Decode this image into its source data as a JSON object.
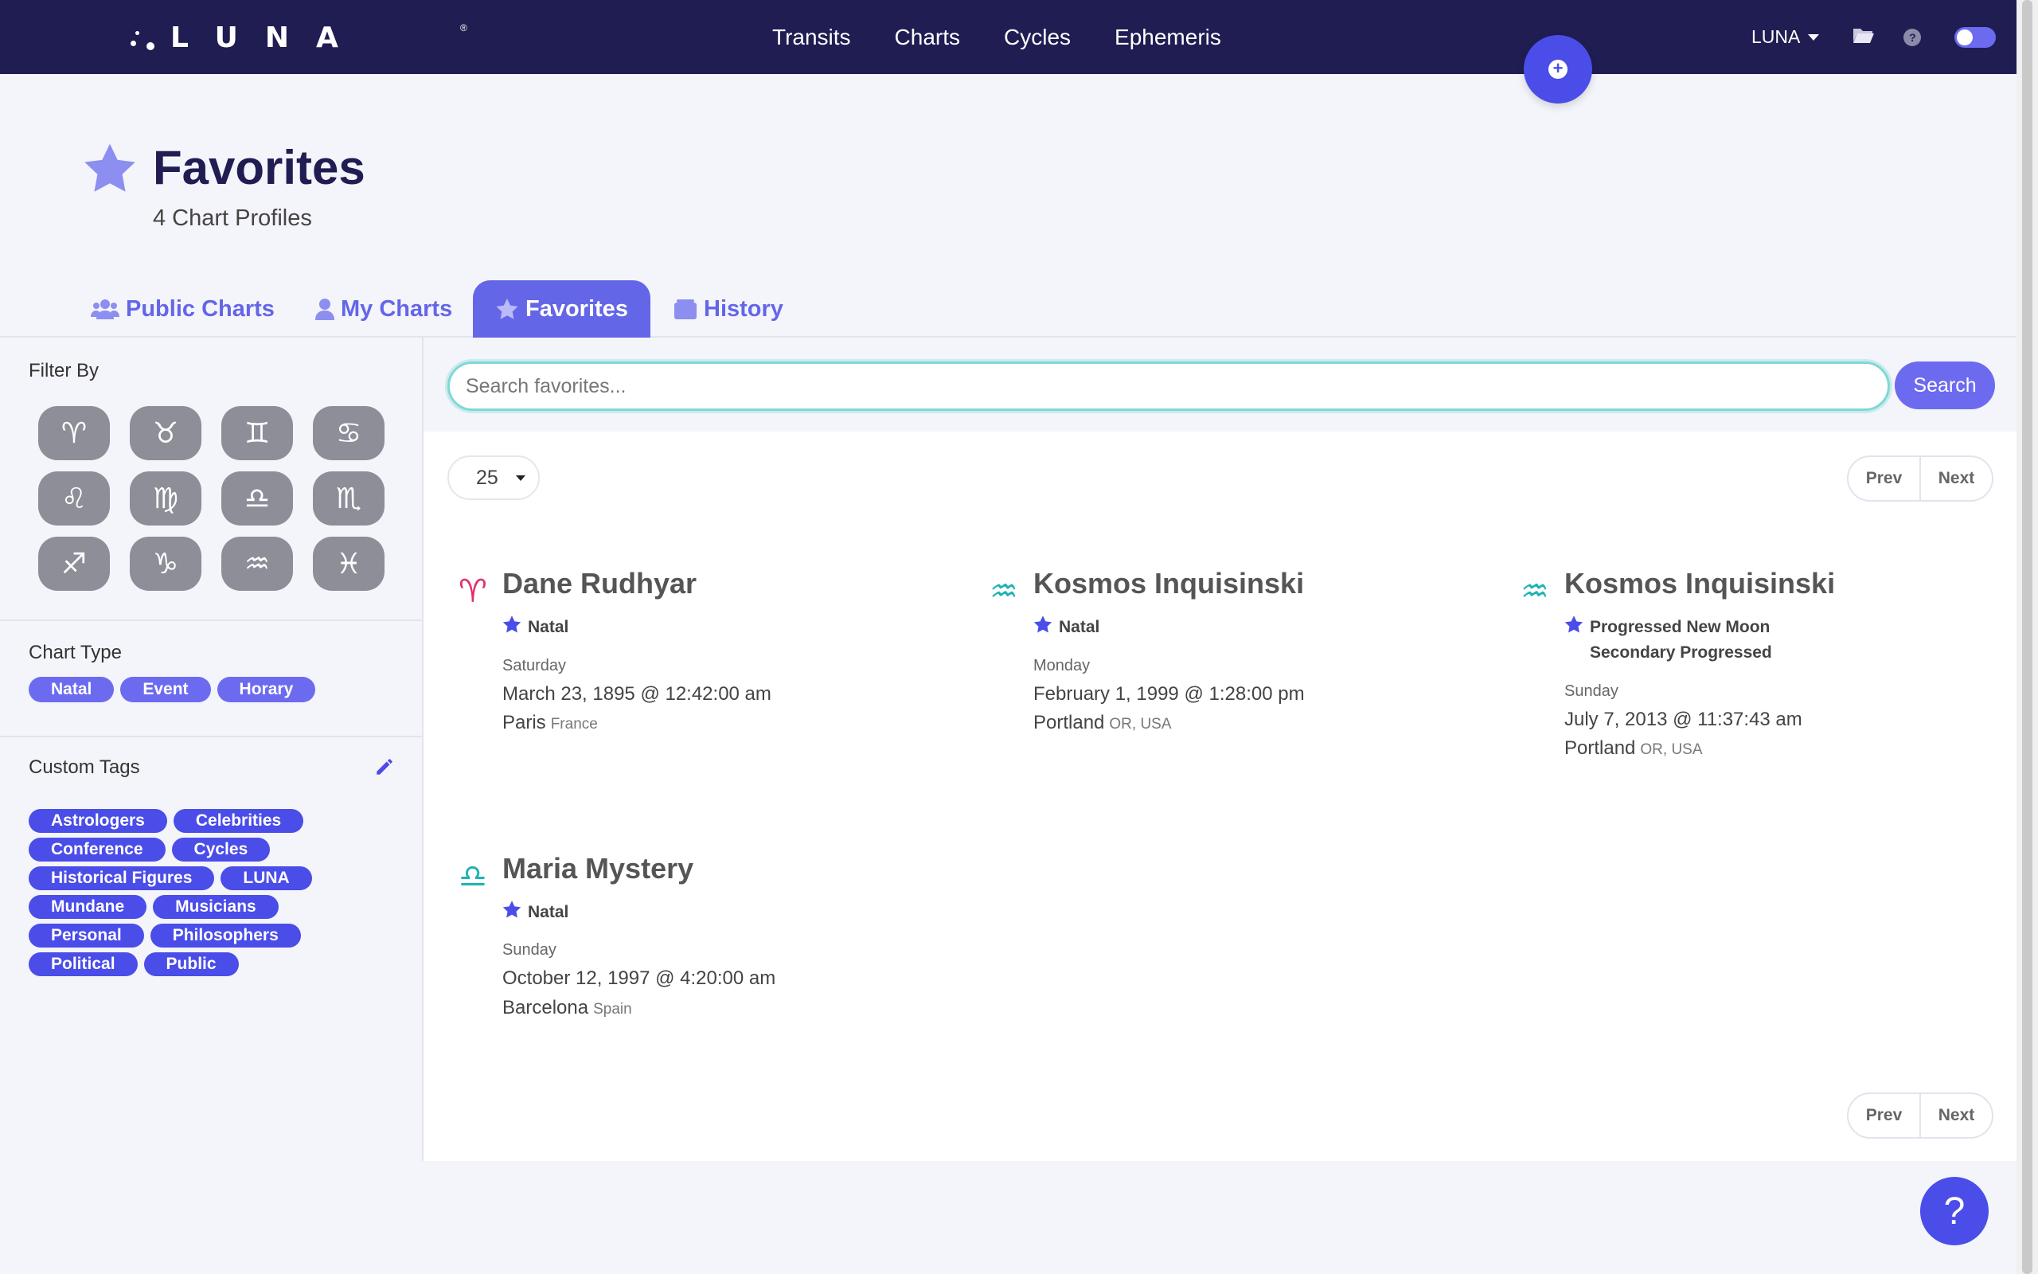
{
  "app": {
    "name": "LUNA",
    "reg_mark": "®"
  },
  "nav": {
    "links": [
      "Transits",
      "Charts",
      "Cycles",
      "Ephemeris"
    ]
  },
  "user_menu": {
    "label": "LUNA"
  },
  "header": {
    "title": "Favorites",
    "subtitle": "4 Chart Profiles"
  },
  "tabs": [
    {
      "label": "Public Charts",
      "icon": "users-icon",
      "active": false
    },
    {
      "label": "My Charts",
      "icon": "user-icon",
      "active": false
    },
    {
      "label": "Favorites",
      "icon": "star-icon",
      "active": true
    },
    {
      "label": "History",
      "icon": "history-icon",
      "active": false
    }
  ],
  "sidebar": {
    "filter_label": "Filter By",
    "zodiac": [
      {
        "name": "aries",
        "glyph": "♈︎"
      },
      {
        "name": "taurus",
        "glyph": "♉︎"
      },
      {
        "name": "gemini",
        "glyph": "♊︎"
      },
      {
        "name": "cancer",
        "glyph": "♋︎"
      },
      {
        "name": "leo",
        "glyph": "♌︎"
      },
      {
        "name": "virgo",
        "glyph": "♍︎"
      },
      {
        "name": "libra",
        "glyph": "♎︎"
      },
      {
        "name": "scorpio",
        "glyph": "♏︎"
      },
      {
        "name": "sagittarius",
        "glyph": "♐︎"
      },
      {
        "name": "capricorn",
        "glyph": "♑︎"
      },
      {
        "name": "aquarius",
        "glyph": "♒︎"
      },
      {
        "name": "pisces",
        "glyph": "♓︎"
      }
    ],
    "chart_type_label": "Chart Type",
    "chart_types": [
      "Natal",
      "Event",
      "Horary"
    ],
    "custom_tags_label": "Custom Tags",
    "custom_tags": [
      "Astrologers",
      "Celebrities",
      "Conference",
      "Cycles",
      "Historical Figures",
      "LUNA",
      "Mundane",
      "Musicians",
      "Personal",
      "Philosophers",
      "Political",
      "Public"
    ]
  },
  "search": {
    "placeholder": "Search favorites...",
    "button_label": "Search"
  },
  "pagination": {
    "per_page": "25",
    "prev": "Prev",
    "next": "Next"
  },
  "charts": [
    {
      "name": "Dane Rudhyar",
      "sign": "aries",
      "sign_glyph": "♈︎",
      "sign_color": "#e0306a",
      "types": [
        "Natal"
      ],
      "day": "Saturday",
      "datetime": "March 23, 1895 @ 12:42:00 am",
      "city": "Paris",
      "region": "France"
    },
    {
      "name": "Kosmos Inquisinski",
      "sign": "aquarius",
      "sign_glyph": "♒︎",
      "sign_color": "#1fb3b3",
      "types": [
        "Natal"
      ],
      "day": "Monday",
      "datetime": "February 1, 1999 @ 1:28:00 pm",
      "city": "Portland",
      "region": "OR, USA"
    },
    {
      "name": "Kosmos Inquisinski",
      "sign": "aquarius",
      "sign_glyph": "♒︎",
      "sign_color": "#1fb3b3",
      "types": [
        "Progressed New Moon",
        "Secondary Progressed"
      ],
      "day": "Sunday",
      "datetime": "July 7, 2013 @ 11:37:43 am",
      "city": "Portland",
      "region": "OR, USA"
    },
    {
      "name": "Maria Mystery",
      "sign": "libra",
      "sign_glyph": "♎︎",
      "sign_color": "#1fb3b3",
      "types": [
        "Natal"
      ],
      "day": "Sunday",
      "datetime": "October 12, 1997 @ 4:20:00 am",
      "city": "Barcelona",
      "region": "Spain"
    }
  ],
  "help_button": {
    "label": "?"
  },
  "colors": {
    "nav_bg": "#1f1d52",
    "accent": "#4a4de8",
    "tab_active": "#6466e8",
    "search_focus": "#7fd8d4"
  }
}
